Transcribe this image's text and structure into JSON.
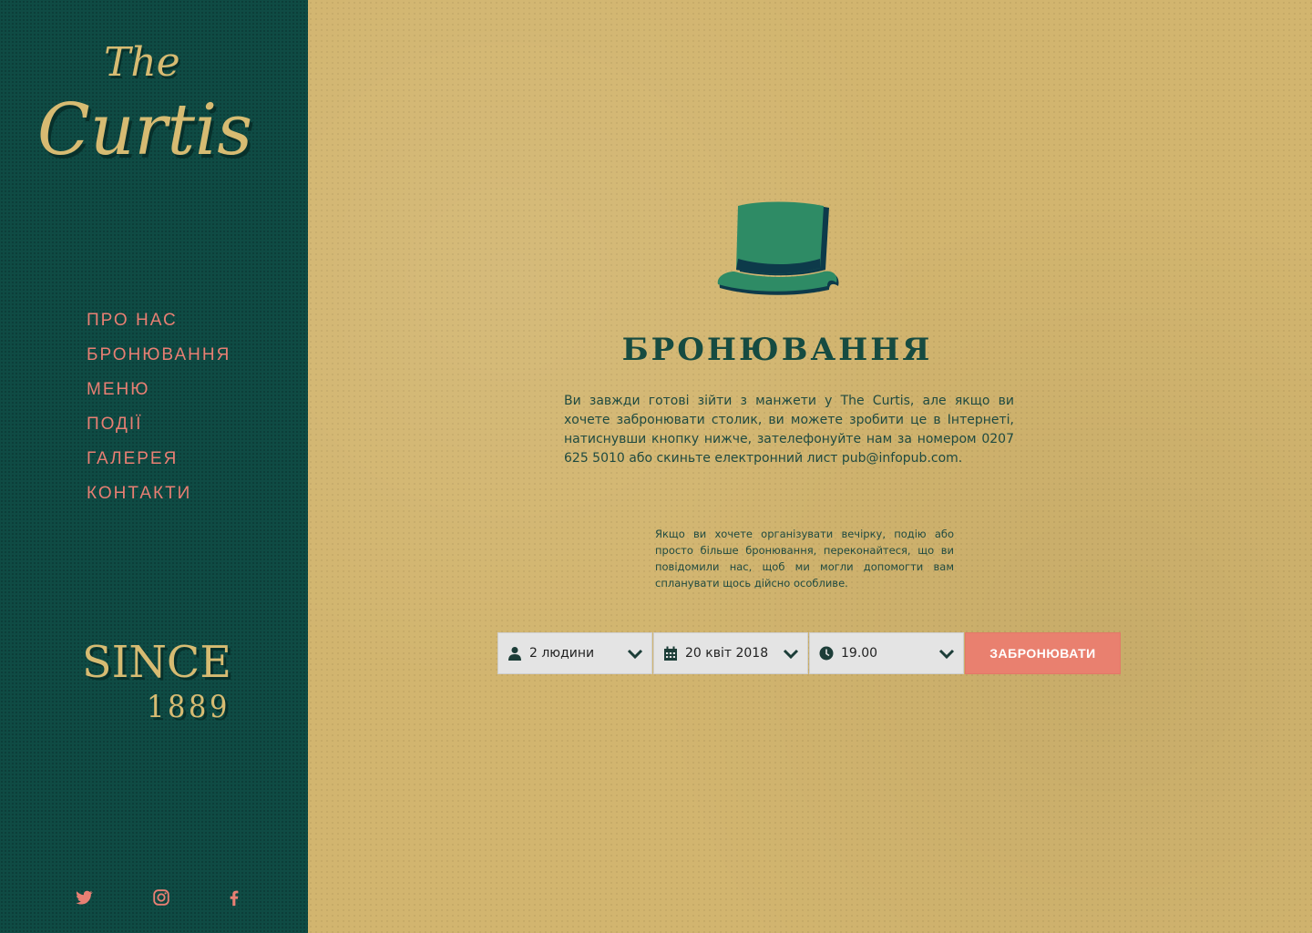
{
  "brand": {
    "logo_the": "The",
    "logo_name": "Curtis",
    "since_word": "SINCE",
    "since_year": "1889"
  },
  "nav": {
    "items": [
      {
        "label": "ПРО НАС"
      },
      {
        "label": "БРОНЮВАННЯ"
      },
      {
        "label": "МЕНЮ"
      },
      {
        "label": "ПОДІЇ"
      },
      {
        "label": "ГАЛЕРЕЯ"
      },
      {
        "label": "КОНТАКТИ"
      }
    ]
  },
  "social": {
    "icons": [
      "twitter-icon",
      "instagram-icon",
      "facebook-icon"
    ]
  },
  "main": {
    "title": "БРОНЮВАННЯ",
    "intro": "Ви завжди готові зійти з манжети у The Curtis, але якщо ви хочете забронювати столик, ви можете зробити це в Інтернеті, натиснувши кнопку нижче, зателефонуйте нам за номером 0207 625 5010 або скиньте електронний лист pub@infopub.com.",
    "note": "Якщо ви хочете організувати вечірку, подію або просто більше бронювання, переконайтеся, що ви повідомили нас, щоб ми могли допомогти вам спланувати щось дійсно особливе."
  },
  "booking": {
    "people": "2 людини",
    "date": "20 квіт 2018",
    "time": "19.00",
    "submit_label": "ЗАБРОНЮВАТИ"
  },
  "colors": {
    "sidebar": "#0f4b44",
    "accent": "#e87f73",
    "gold": "#d7bb72",
    "paper": "#d2b56f",
    "heading": "#164b41"
  }
}
